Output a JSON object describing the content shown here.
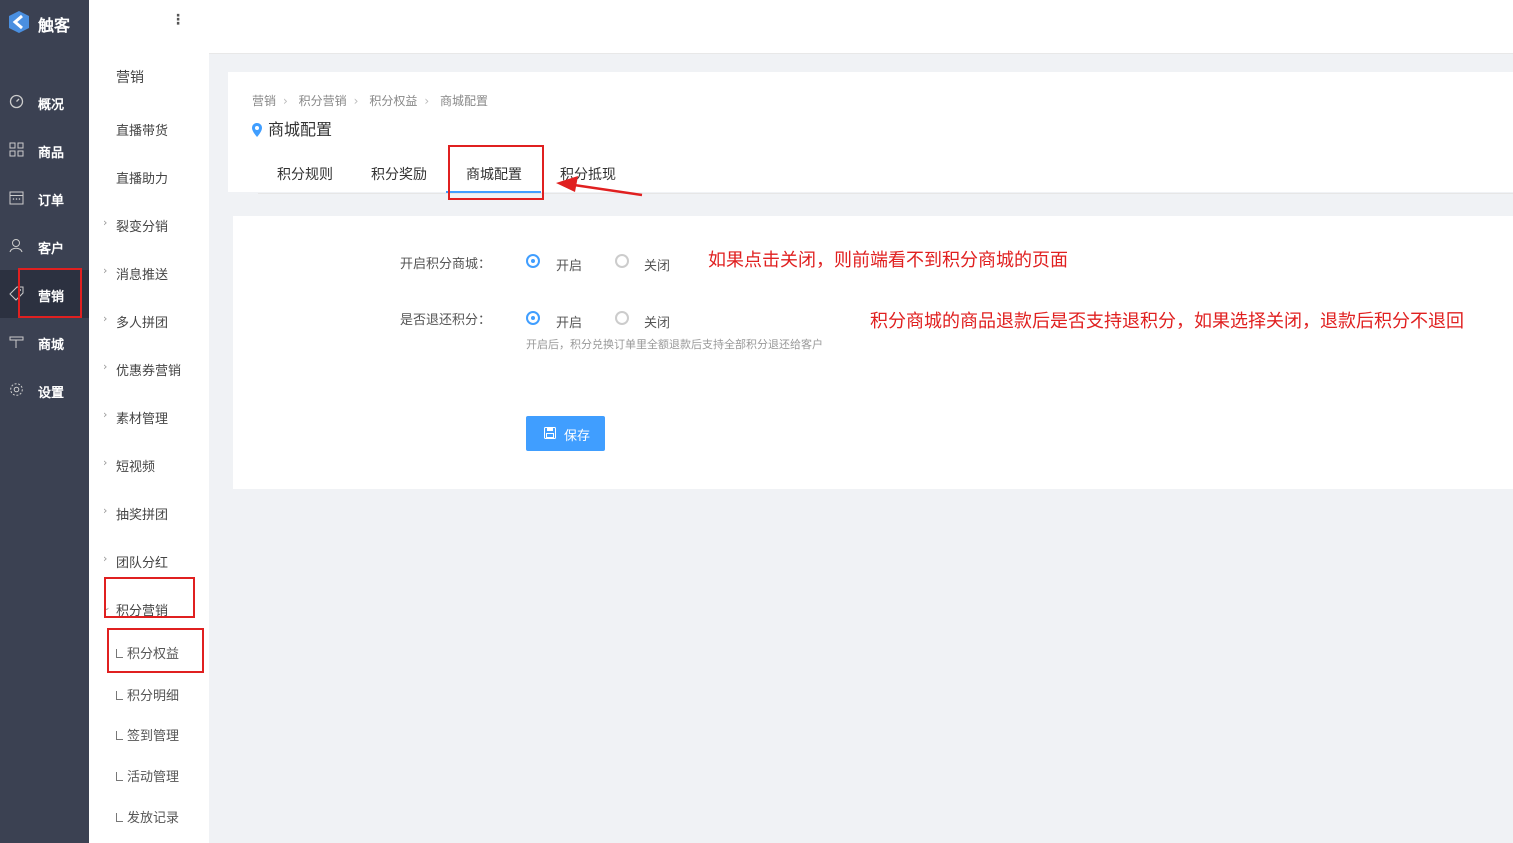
{
  "app": {
    "name": "触客"
  },
  "nav": {
    "items": [
      {
        "label": "概况",
        "icon": "dashboard-icon"
      },
      {
        "label": "商品",
        "icon": "grid-icon"
      },
      {
        "label": "订单",
        "icon": "calendar-icon"
      },
      {
        "label": "客户",
        "icon": "user-icon"
      },
      {
        "label": "营销",
        "icon": "tag-icon",
        "active": true
      },
      {
        "label": "商城",
        "icon": "shop-icon"
      },
      {
        "label": "设置",
        "icon": "gear-icon"
      }
    ]
  },
  "subnav": {
    "title": "营销",
    "items": [
      {
        "label": "直播带货"
      },
      {
        "label": "直播助力"
      },
      {
        "label": "裂变分销"
      },
      {
        "label": "消息推送"
      },
      {
        "label": "多人拼团"
      },
      {
        "label": "优惠券营销"
      },
      {
        "label": "素材管理"
      },
      {
        "label": "短视频"
      },
      {
        "label": "抽奖拼团"
      },
      {
        "label": "团队分红"
      },
      {
        "label": "积分营销"
      }
    ],
    "children": [
      {
        "label": "积分权益"
      },
      {
        "label": "积分明细"
      },
      {
        "label": "签到管理"
      },
      {
        "label": "活动管理"
      },
      {
        "label": "发放记录"
      }
    ]
  },
  "breadcrumb": [
    "营销",
    "积分营销",
    "积分权益",
    "商城配置"
  ],
  "page_title": "商城配置",
  "tabs": [
    {
      "label": "积分规则"
    },
    {
      "label": "积分奖励"
    },
    {
      "label": "商城配置",
      "active": true
    },
    {
      "label": "积分抵现"
    }
  ],
  "form": {
    "mall_switch": {
      "label": "开启积分商城：",
      "on": "开启",
      "off": "关闭",
      "selected": "开启"
    },
    "refund_points": {
      "label": "是否退还积分：",
      "on": "开启",
      "off": "关闭",
      "selected": "开启",
      "hint": "开启后，积分兑换订单里全额退款后支持全部积分退还给客户"
    },
    "save_label": "保存"
  },
  "annotations": {
    "note1": "如果点击关闭，则前端看不到积分商城的页面",
    "note2": "积分商城的商品退款后是否支持退积分，如果选择关闭，退款后积分不退回"
  },
  "colors": {
    "primary": "#409eff",
    "sidebar": "#3b4152",
    "annotation": "#e02020"
  }
}
